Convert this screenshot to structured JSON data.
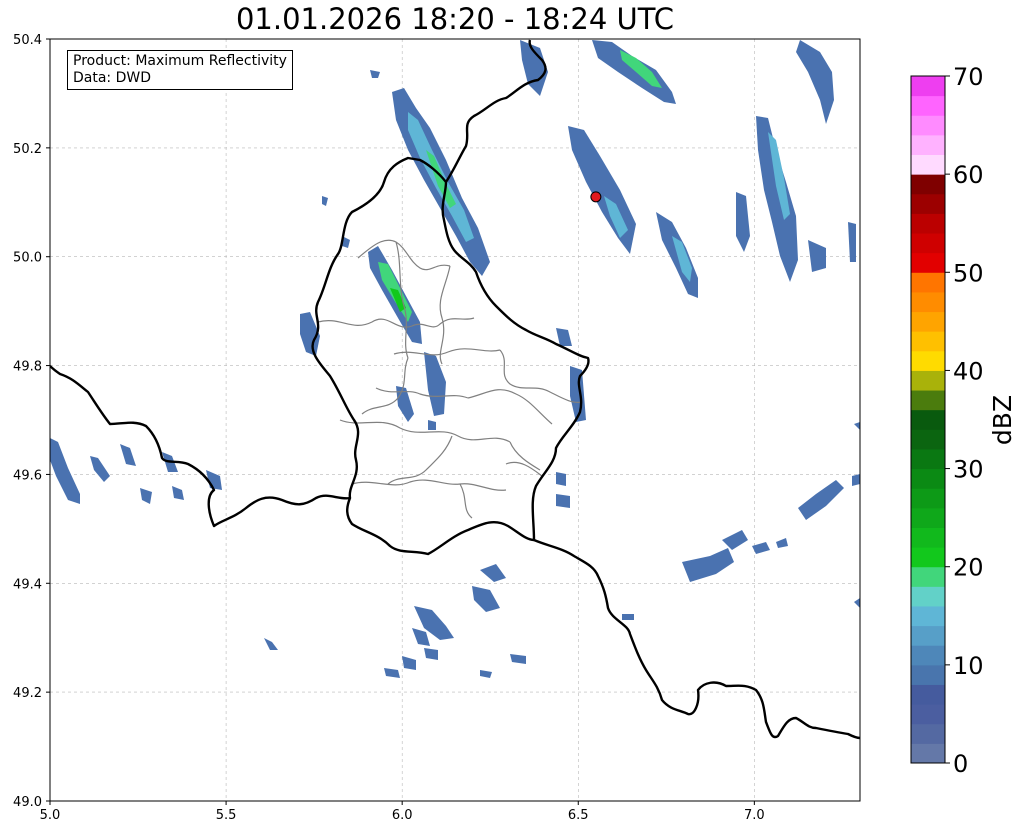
{
  "title": "01.01.2026 18:20 - 18:24 UTC",
  "info": {
    "product": "Product: Maximum Reflectivity",
    "data_source": "Data: DWD"
  },
  "map": {
    "lon_range": [
      5.0,
      7.3
    ],
    "lat_range": [
      49.0,
      50.4
    ],
    "lon_ticks": [
      "5.0",
      "5.5",
      "6.0",
      "6.5",
      "7.0"
    ],
    "lat_ticks": [
      "49.0",
      "49.2",
      "49.4",
      "49.6",
      "49.8",
      "50.0",
      "50.2",
      "50.4"
    ],
    "gridlines": true,
    "radar_site": {
      "lon": 6.55,
      "lat": 50.11,
      "color": "#e0191e"
    }
  },
  "colorbar": {
    "label": "dBZ",
    "tick_labels": [
      "0",
      "10",
      "20",
      "30",
      "40",
      "50",
      "60",
      "70"
    ],
    "colors": [
      "#6478a8",
      "#5469a2",
      "#4b5ea0",
      "#455b9e",
      "#4975ad",
      "#4e87b9",
      "#579fc8",
      "#5fb6d6",
      "#62d1c8",
      "#41d67b",
      "#12c81c",
      "#11b91c",
      "#0fa81a",
      "#0d9a17",
      "#0b8a14",
      "#0a7812",
      "#0b6510",
      "#095a0e",
      "#4b7c0d",
      "#a9b20a",
      "#ffdb00",
      "#ffc000",
      "#ffa400",
      "#ff8c00",
      "#ff7500",
      "#e20000",
      "#cf0000",
      "#bb0000",
      "#9c0000",
      "#7f0000",
      "#ffdaff",
      "#ffb2ff",
      "#ff8bff",
      "#ff64ff",
      "#ee3ef0"
    ]
  }
}
